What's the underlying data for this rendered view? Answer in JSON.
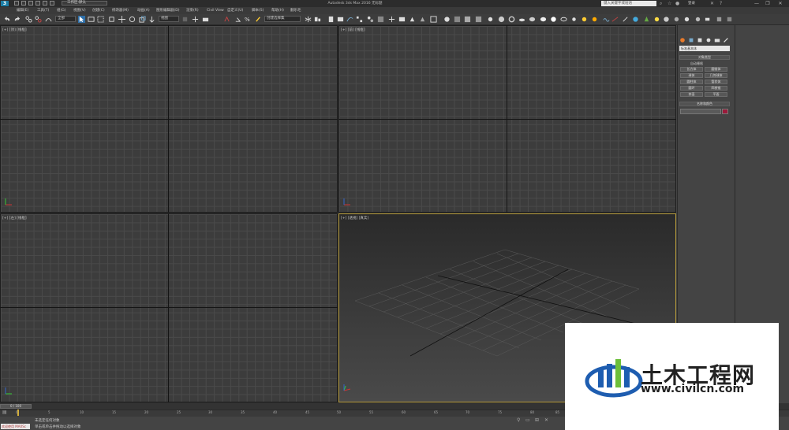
{
  "titlebar": {
    "workspace": "工作区:默认",
    "app_title": "Autodesk 3ds Max 2016    无标题",
    "search_placeholder": "键入关键字或短语",
    "login": "登录",
    "minimize": "—",
    "restore": "❐",
    "close": "✕"
  },
  "menu": [
    "编辑(E)",
    "工具(T)",
    "组(G)",
    "视图(V)",
    "创建(C)",
    "修改器(M)",
    "动画(A)",
    "图形编辑器(D)",
    "渲染(R)",
    "Civil View",
    "自定义(U)",
    "脚本(S)",
    "帮助(H)",
    "翻乐毛"
  ],
  "toolbar": {
    "filter_dropdown": "全部",
    "reference_dropdown": "视图",
    "selection_set": "创建选择集"
  },
  "viewports": {
    "top_left": "[+] [顶] [线框]",
    "top_right": "[+] [前] [线框]",
    "bottom_left": "[+] [左] [线框]",
    "bottom_right": "[+] [透视] [真实]"
  },
  "command_panel": {
    "category_dropdown": "标准基本体",
    "object_type_title": "对象类型",
    "autogrid": "自动栅格",
    "buttons": [
      "长方体",
      "圆锥体",
      "球体",
      "几何球体",
      "圆柱体",
      "管状体",
      "圆环",
      "四棱锥",
      "茶壶",
      "平面"
    ],
    "name_color_title": "名称和颜色",
    "object_color": "#9a1a3a"
  },
  "timeline": {
    "frame_counter": "0 / 100",
    "ticks": [
      "0",
      "5",
      "10",
      "15",
      "20",
      "25",
      "30",
      "35",
      "40",
      "45",
      "50",
      "55",
      "60",
      "65",
      "70",
      "75",
      "80",
      "85"
    ]
  },
  "status": {
    "maxscript_label": "欢迎使用 MAXSc",
    "line1": "未选定任何对象",
    "line2": "单击或单击并拖动以选择对象"
  },
  "watermark": {
    "brand": "土木工程网",
    "url": "www.civilcn.com"
  },
  "colors": {
    "accent": "#1d7fa8",
    "active_viewport_border": "#b59a3a",
    "object_color": "#9a1a3a"
  }
}
